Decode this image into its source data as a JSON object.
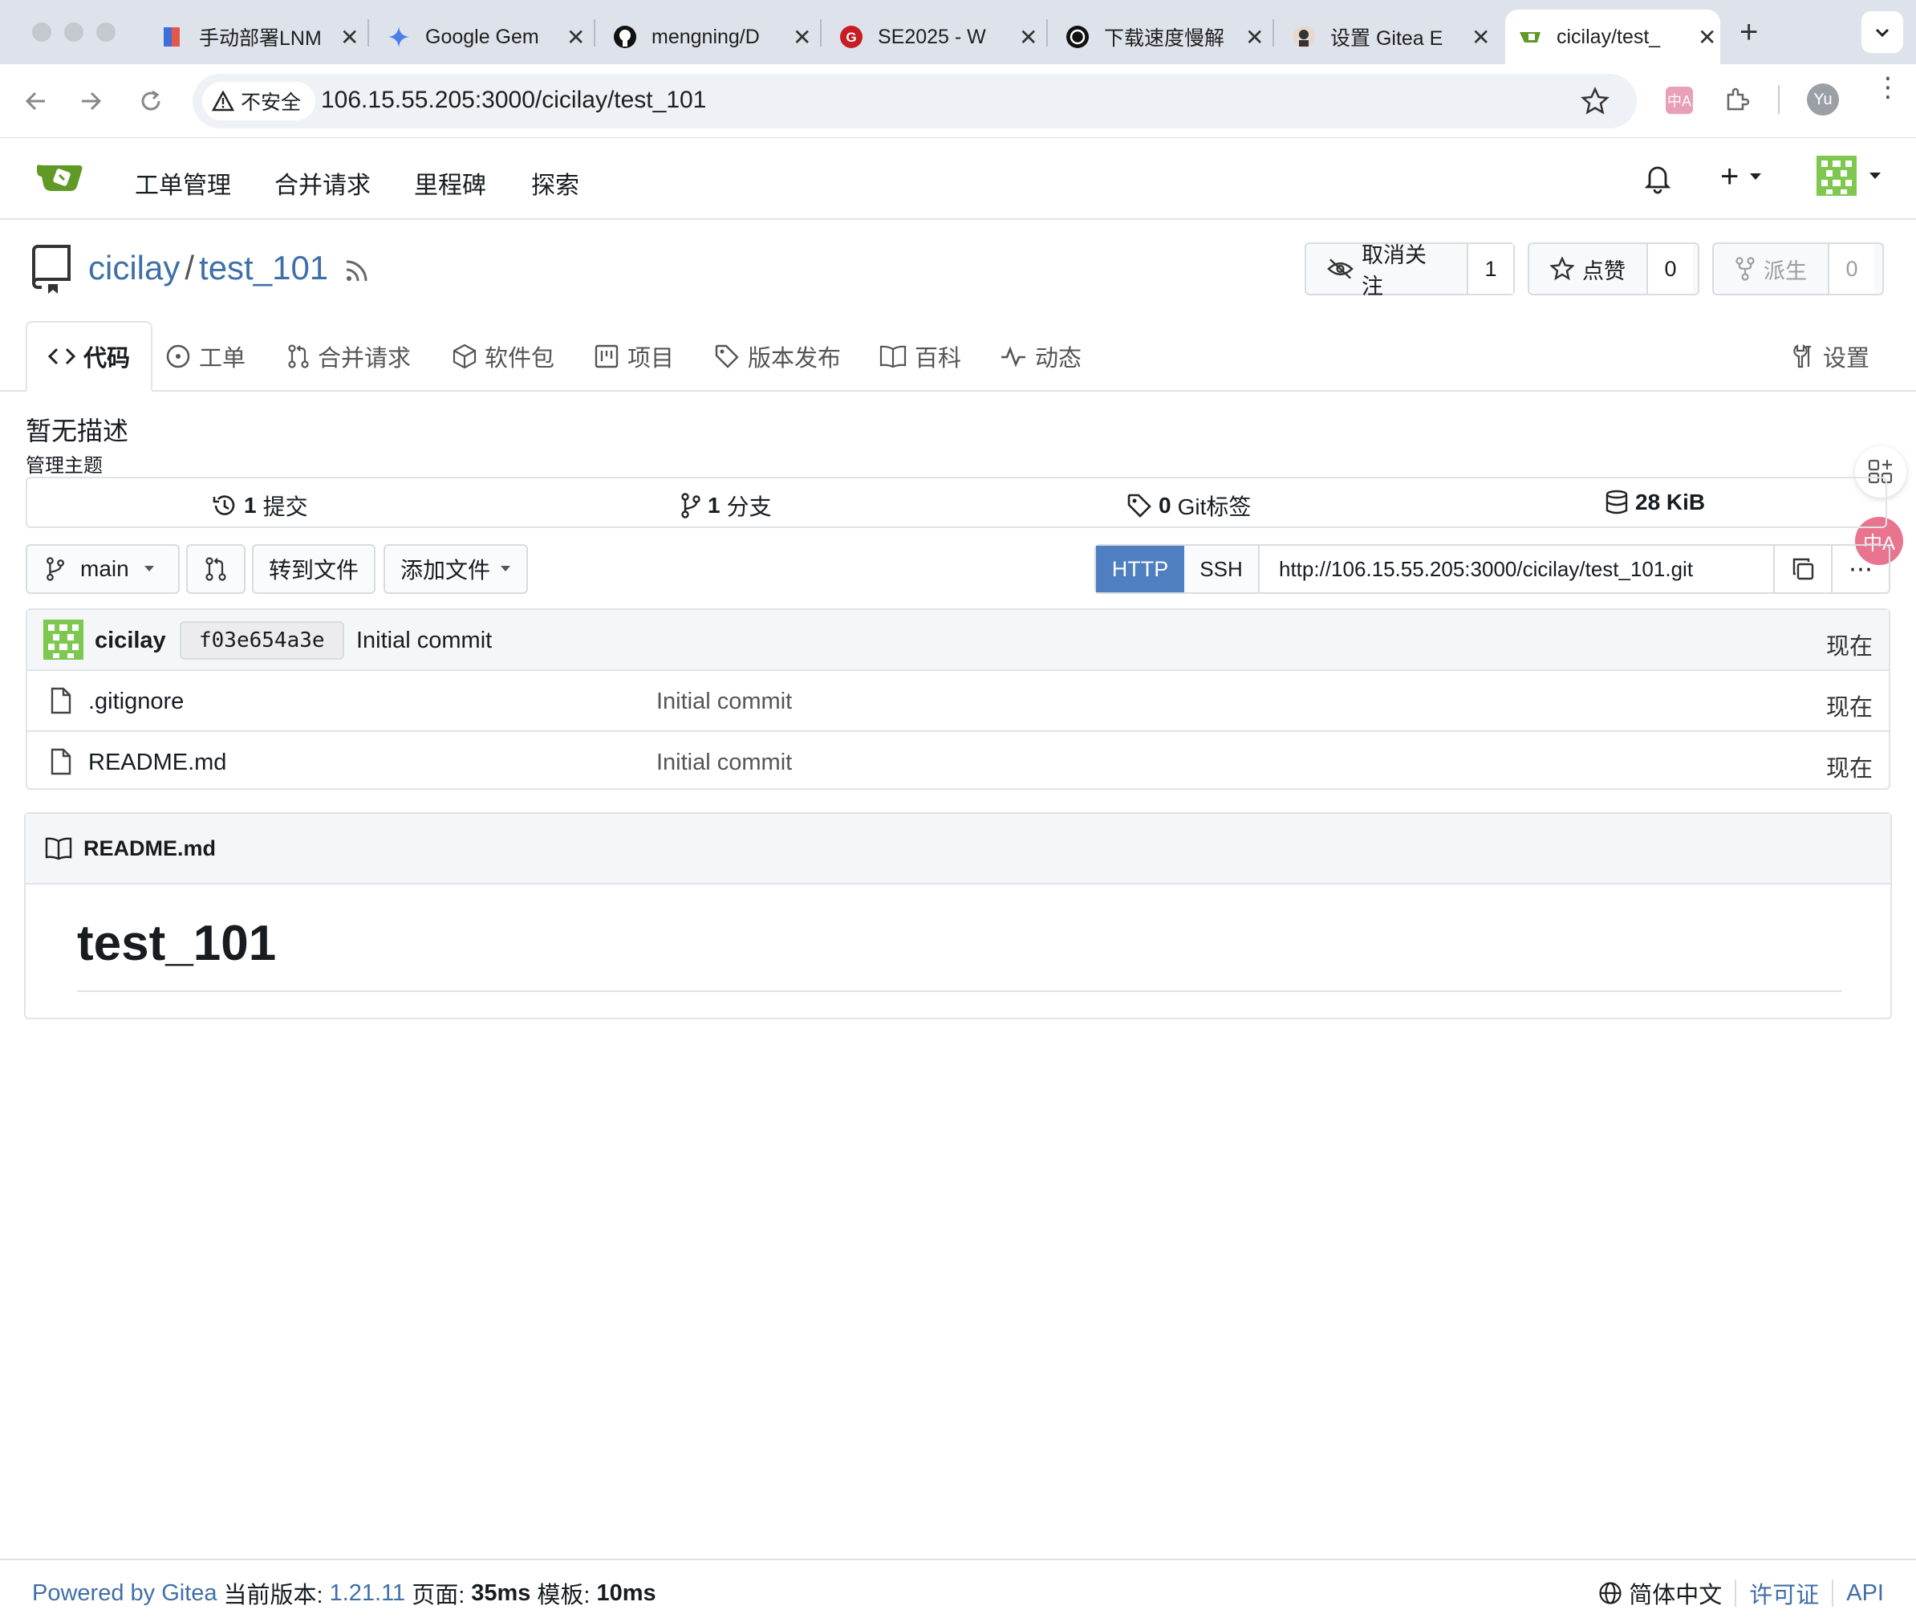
{
  "browser": {
    "tabs": [
      {
        "title": "手动部署LNM",
        "active": false
      },
      {
        "title": "Google Gem",
        "active": false
      },
      {
        "title": "mengning/D",
        "active": false
      },
      {
        "title": "SE2025 - W",
        "active": false
      },
      {
        "title": "下载速度慢解",
        "active": false
      },
      {
        "title": "设置 Gitea E",
        "active": false
      },
      {
        "title": "cicilay/test_",
        "active": true
      }
    ],
    "security_label": "不安全",
    "url": "106.15.55.205:3000/cicilay/test_101",
    "profile_initials": "Yu"
  },
  "header": {
    "nav": [
      "工单管理",
      "合并请求",
      "里程碑",
      "探索"
    ]
  },
  "repo": {
    "owner": "cicilay",
    "separator": "/",
    "name": "test_101",
    "watch_label": "取消关注",
    "watch_count": "1",
    "star_label": "点赞",
    "star_count": "0",
    "fork_label": "派生",
    "fork_count": "0",
    "tabs": [
      "代码",
      "工单",
      "合并请求",
      "软件包",
      "项目",
      "版本发布",
      "百科",
      "动态"
    ],
    "settings_label": "设置",
    "description": "暂无描述",
    "manage_topics": "管理主题",
    "stats": {
      "commits_num": "1",
      "commits_label": "提交",
      "branches_num": "1",
      "branches_label": "分支",
      "tags_num": "0",
      "tags_label": "Git标签",
      "size": "28 KiB"
    },
    "branch": "main",
    "goto_file": "转到文件",
    "add_file": "添加文件",
    "clone": {
      "http": "HTTP",
      "ssh": "SSH",
      "url": "http://106.15.55.205:3000/cicilay/test_101.git"
    },
    "latest_commit": {
      "author": "cicilay",
      "sha": "f03e654a3e",
      "message": "Initial commit",
      "time": "现在"
    },
    "files": [
      {
        "name": ".gitignore",
        "message": "Initial commit",
        "time": "现在"
      },
      {
        "name": "README.md",
        "message": "Initial commit",
        "time": "现在"
      }
    ],
    "readme": {
      "filename": "README.md",
      "heading": "test_101"
    }
  },
  "footer": {
    "powered_by": "Powered by Gitea",
    "version_label": "当前版本:",
    "version": "1.21.11",
    "page_label": "页面:",
    "page_time": "35ms",
    "template_label": "模板:",
    "template_time": "10ms",
    "language": "简体中文",
    "license": "许可证",
    "api": "API"
  },
  "colors": {
    "accent": "#4f7fc1",
    "link": "#3f6fa8",
    "gitea_green": "#609926"
  }
}
